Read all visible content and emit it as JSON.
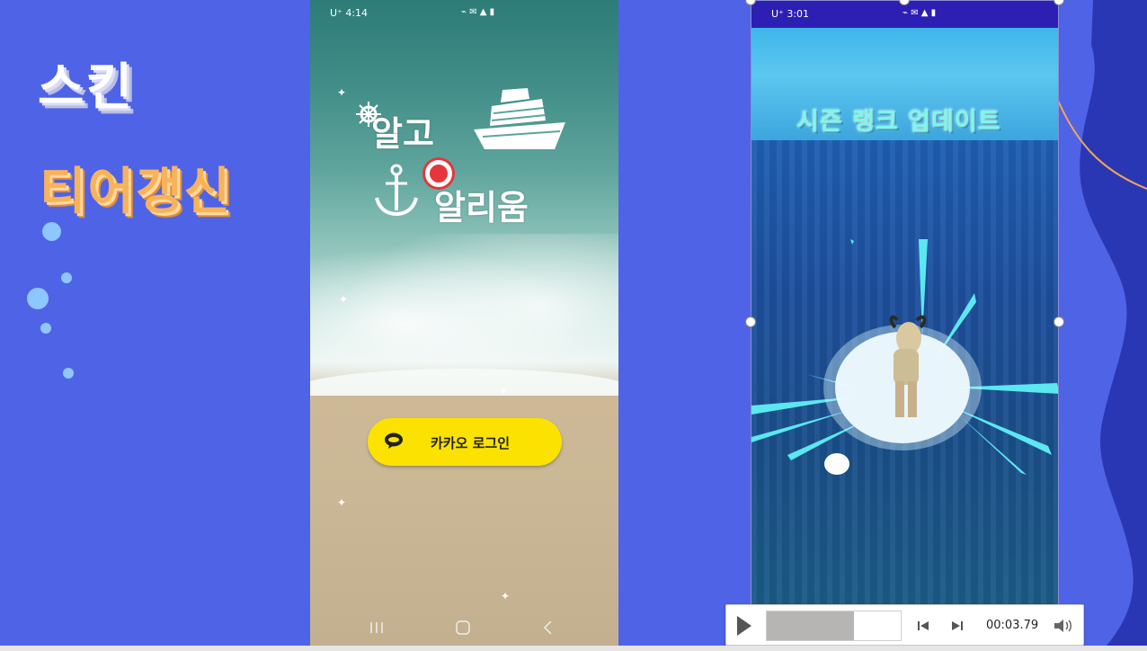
{
  "slide": {
    "title_skin": "스킨",
    "title_tier": "티어갱신"
  },
  "phone_login": {
    "status_time": "U⁺ 4:14",
    "app_title_line1": "알고",
    "app_title_line2": "알리움",
    "kakao_button_label": "카카오 로그인",
    "kakao_icon": "kakao-talk-icon"
  },
  "phone_rank": {
    "status_time": "U⁺ 3:01",
    "banner_title": "시즌 랭크 업데이트"
  },
  "media_player": {
    "time": "00:03.79",
    "progress": 0.65,
    "icons": [
      "play-icon",
      "previous-frame-icon",
      "next-frame-icon",
      "volume-icon"
    ]
  },
  "colors": {
    "background": "#4f63e6",
    "title_skin": "#ffffff",
    "title_tier": "#f8b35a",
    "kakao_yellow": "#fbe200",
    "rank_title": "#7ff6e8"
  }
}
